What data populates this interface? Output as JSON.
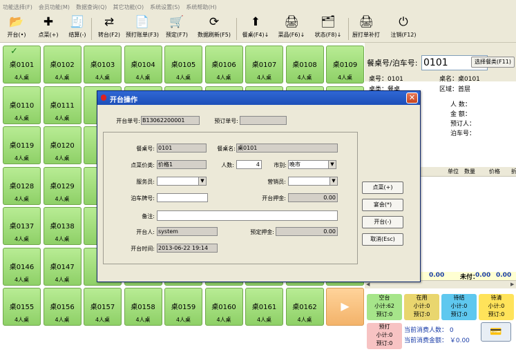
{
  "menu": [
    "功能选择(F)",
    "会员功能(M)",
    "数据查询(Q)",
    "其它功能(O)",
    "系统设置(S)",
    "系统帮助(H)"
  ],
  "toolbar": [
    {
      "label": "开台(•)",
      "icon": "open-table-icon",
      "glyph": "📂"
    },
    {
      "label": "点菜(+)",
      "icon": "add-dish-icon",
      "glyph": "✚"
    },
    {
      "label": "结算(-)",
      "icon": "checkout-icon",
      "glyph": "🧾"
    },
    {
      "label": "转台(F2)",
      "icon": "transfer-table-icon",
      "glyph": "⇄"
    },
    {
      "label": "预打账单(F3)",
      "icon": "preprint-bill-icon",
      "glyph": "📄"
    },
    {
      "label": "预定(F7)",
      "icon": "reserve-cart-icon",
      "glyph": "🛒"
    },
    {
      "label": "数据刷新(F5)",
      "icon": "refresh-icon",
      "glyph": "⟳"
    },
    {
      "label": "餐桌(F4)↓",
      "icon": "table-up-arrow-icon",
      "glyph": "⬆"
    },
    {
      "label": "菜品(F6)↓",
      "icon": "dish-printer-icon",
      "glyph": "🖨"
    },
    {
      "label": "状态(F8)↓",
      "icon": "status-icon",
      "glyph": "🗂"
    },
    {
      "label": "厨打单补打",
      "icon": "kitchen-print-icon",
      "glyph": "🖨"
    },
    {
      "label": "注销(F12)",
      "icon": "power-icon",
      "glyph": "⏻"
    }
  ],
  "tiles": [
    {
      "name": "桌0101",
      "cap": "4人桌",
      "checked": true
    },
    {
      "name": "桌0102",
      "cap": "4人桌"
    },
    {
      "name": "桌0103",
      "cap": "4人桌"
    },
    {
      "name": "桌0104",
      "cap": "4人桌"
    },
    {
      "name": "桌0105",
      "cap": "4人桌"
    },
    {
      "name": "桌0106",
      "cap": "4人桌"
    },
    {
      "name": "桌0107",
      "cap": "4人桌"
    },
    {
      "name": "桌0108",
      "cap": "4人桌"
    },
    {
      "name": "桌0109",
      "cap": "4人桌"
    },
    {
      "name": "桌0110",
      "cap": "4人桌"
    },
    {
      "name": "桌0111",
      "cap": "4人桌"
    },
    {
      "name": "",
      "cap": ""
    },
    {
      "name": "",
      "cap": ""
    },
    {
      "name": "",
      "cap": ""
    },
    {
      "name": "",
      "cap": ""
    },
    {
      "name": "",
      "cap": ""
    },
    {
      "name": "",
      "cap": ""
    },
    {
      "name": "",
      "cap": "4人桌"
    },
    {
      "name": "桌0119",
      "cap": "4人桌"
    },
    {
      "name": "桌0120",
      "cap": "4人桌"
    },
    {
      "name": "",
      "cap": ""
    },
    {
      "name": "",
      "cap": ""
    },
    {
      "name": "",
      "cap": ""
    },
    {
      "name": "",
      "cap": ""
    },
    {
      "name": "",
      "cap": ""
    },
    {
      "name": "",
      "cap": ""
    },
    {
      "name": "",
      "cap": ""
    },
    {
      "name": "桌0128",
      "cap": "4人桌"
    },
    {
      "name": "桌0129",
      "cap": "4人桌"
    },
    {
      "name": "",
      "cap": ""
    },
    {
      "name": "",
      "cap": ""
    },
    {
      "name": "",
      "cap": ""
    },
    {
      "name": "",
      "cap": ""
    },
    {
      "name": "",
      "cap": ""
    },
    {
      "name": "",
      "cap": ""
    },
    {
      "name": "",
      "cap": ""
    },
    {
      "name": "桌0137",
      "cap": "4人桌"
    },
    {
      "name": "桌0138",
      "cap": "4人桌"
    },
    {
      "name": "",
      "cap": ""
    },
    {
      "name": "",
      "cap": ""
    },
    {
      "name": "",
      "cap": ""
    },
    {
      "name": "",
      "cap": ""
    },
    {
      "name": "",
      "cap": ""
    },
    {
      "name": "",
      "cap": ""
    },
    {
      "name": "",
      "cap": ""
    },
    {
      "name": "桌0146",
      "cap": "4人桌"
    },
    {
      "name": "桌0147",
      "cap": "4人桌"
    },
    {
      "name": "",
      "cap": ""
    },
    {
      "name": "",
      "cap": ""
    },
    {
      "name": "",
      "cap": ""
    },
    {
      "name": "",
      "cap": ""
    },
    {
      "name": "",
      "cap": ""
    },
    {
      "name": "",
      "cap": ""
    },
    {
      "name": "",
      "cap": ""
    },
    {
      "name": "桌0155",
      "cap": "4人桌"
    },
    {
      "name": "桌0156",
      "cap": "4人桌"
    },
    {
      "name": "桌0157",
      "cap": "4人桌"
    },
    {
      "name": "桌0158",
      "cap": "4人桌"
    },
    {
      "name": "桌0159",
      "cap": "4人桌"
    },
    {
      "name": "桌0160",
      "cap": "4人桌"
    },
    {
      "name": "桌0161",
      "cap": "4人桌"
    },
    {
      "name": "桌0162",
      "cap": "4人桌"
    },
    {
      "name": "",
      "cap": "",
      "next": true
    }
  ],
  "right": {
    "search_label": "餐桌号/泊车号:",
    "search_value": "0101",
    "select_btn": "选择餐类(F11)",
    "info": {
      "table_no": "桌号：0101",
      "table_name": "桌名：桌0101",
      "table_type": "桌类：餐桌",
      "area": "区域：首层",
      "persons": "人 数：",
      "amount": "金 额：",
      "reserver": "预订人：",
      "parking": "泊车号："
    },
    "grid_headers": [
      "单位",
      "数量",
      "价格",
      "折"
    ],
    "totals": {
      "left": "0.00",
      "unpaid_label": "未付：",
      "unpaid": "0.00",
      "right": "0.00"
    },
    "status": [
      {
        "title": "空台",
        "l1": "小计:62",
        "l2": "预订:0",
        "color": "#a6e58a"
      },
      {
        "title": "在用",
        "l1": "小计:0",
        "l2": "预订:0",
        "color": "#e9d66e"
      },
      {
        "title": "待结",
        "l1": "小计:0",
        "l2": "预订:0",
        "color": "#5fc8ef"
      },
      {
        "title": "待清",
        "l1": "小计:0",
        "l2": "预订:0",
        "color": "#ffe35a"
      },
      {
        "title": "预打",
        "l1": "小计:0",
        "l2": "预订:0",
        "color": "#f7c3c3"
      }
    ],
    "current_people": "当前消费人数： 0",
    "current_amount": "当前消费金额： ￥0.00"
  },
  "dialog": {
    "title": "开台操作",
    "order_no_label": "开台单号:",
    "order_no": "B13062200001",
    "reserve_no_label": "预订单号:",
    "reserve_no": "",
    "table_no_label": "餐桌号:",
    "table_no": "0101",
    "table_name_label": "餐桌名:",
    "table_name": "桌0101",
    "price_class_label": "点菜价类:",
    "price_class": "价格1",
    "persons_label": "人数:",
    "persons": "4",
    "market_label": "市别:",
    "market": "晚市",
    "waiter_label": "服务员:",
    "waiter": "",
    "sales_label": "营销员:",
    "sales": "",
    "parking_label": "泊车牌号:",
    "parking": "",
    "deposit_label": "开台押金:",
    "deposit": "0.00",
    "note_label": "备注:",
    "note": "",
    "opener_label": "开台人:",
    "opener": "system",
    "reserve_deposit_label": "预定押金:",
    "reserve_deposit": "0.00",
    "open_time_label": "开台时间:",
    "open_time": "2013-06-22 19:14",
    "buttons": [
      "点菜(+)",
      "宴会(*)",
      "开台(-)",
      "取消(Esc)"
    ]
  }
}
